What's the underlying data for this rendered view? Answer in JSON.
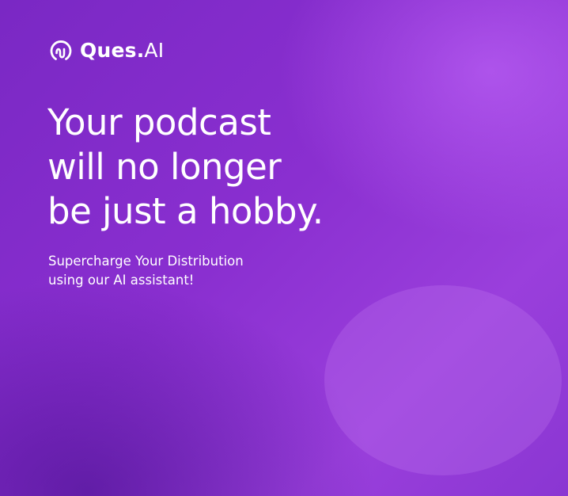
{
  "brand": {
    "name": "Ques",
    "dot": ".",
    "suffix": "AI",
    "logo_icon": "soundwave-loop-icon"
  },
  "hero": {
    "headline_lines": [
      "Your podcast",
      "will no longer",
      "be just a hobby."
    ],
    "subhead_lines": [
      "Supercharge Your Distribution",
      "using our AI assistant!"
    ]
  },
  "theme": {
    "background": "#8a2fd0",
    "wave_color": "#f3d9ff",
    "text_color": "#ffffff"
  }
}
